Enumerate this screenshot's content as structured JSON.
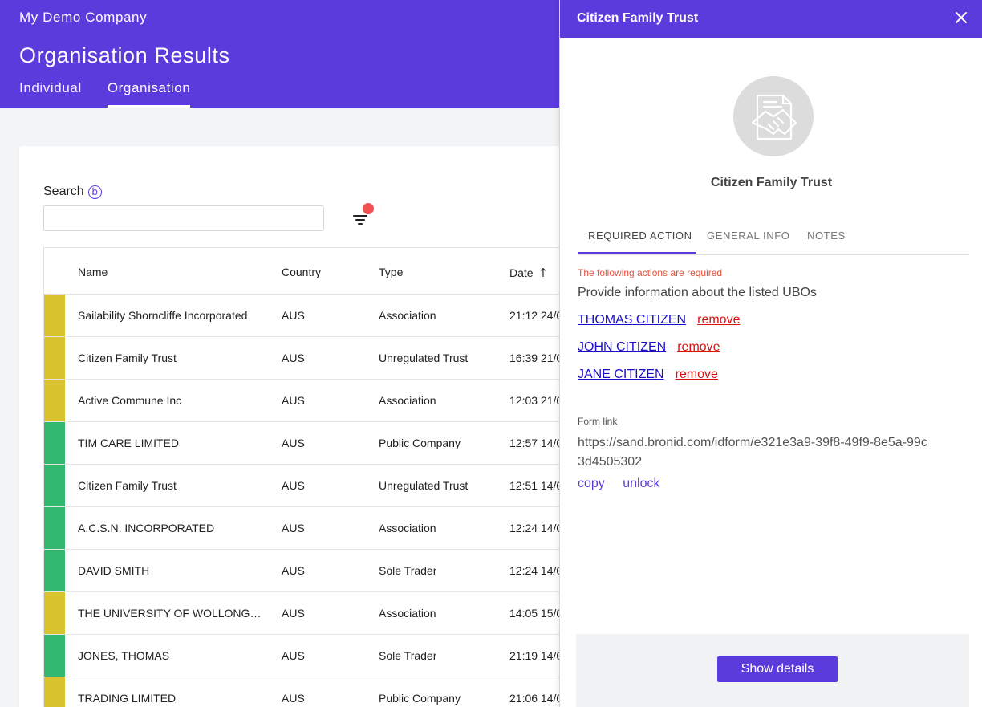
{
  "header": {
    "company": "My Demo Company",
    "title": "Organisation Results",
    "tabs": [
      {
        "label": "Individual",
        "active": false
      },
      {
        "label": "Organisation",
        "active": true
      }
    ]
  },
  "search": {
    "label": "Search",
    "info_icon": "b",
    "value": "",
    "placeholder": ""
  },
  "table": {
    "columns": [
      "Name",
      "Country",
      "Type",
      "Date"
    ],
    "sort_icon": "↑",
    "rows": [
      {
        "name": "Sailability Shorncliffe Incorporated",
        "country": "AUS",
        "type": "Association",
        "date": "21:12 24/0",
        "status": "yellow"
      },
      {
        "name": "Citizen Family Trust",
        "country": "AUS",
        "type": "Unregulated Trust",
        "date": "16:39 21/0",
        "status": "yellow"
      },
      {
        "name": "Active Commune Inc",
        "country": "AUS",
        "type": "Association",
        "date": "12:03 21/0",
        "status": "yellow"
      },
      {
        "name": "TIM CARE LIMITED",
        "country": "AUS",
        "type": "Public Company",
        "date": "12:57 14/0",
        "status": "green"
      },
      {
        "name": "Citizen Family Trust",
        "country": "AUS",
        "type": "Unregulated Trust",
        "date": "12:51 14/0",
        "status": "green"
      },
      {
        "name": "A.C.S.N. INCORPORATED",
        "country": "AUS",
        "type": "Association",
        "date": "12:24 14/0",
        "status": "green"
      },
      {
        "name": "DAVID SMITH",
        "country": "AUS",
        "type": "Sole Trader",
        "date": "12:24 14/0",
        "status": "green"
      },
      {
        "name": "THE UNIVERSITY OF WOLLONGO…",
        "country": "AUS",
        "type": "Association",
        "date": "14:05 15/0",
        "status": "yellow"
      },
      {
        "name": "JONES, THOMAS",
        "country": "AUS",
        "type": "Sole Trader",
        "date": "21:19 14/0",
        "status": "green"
      },
      {
        "name": "TRADING LIMITED",
        "country": "AUS",
        "type": "Public Company",
        "date": "21:06 14/0",
        "status": "yellow"
      }
    ]
  },
  "colors": {
    "accent": "#5b3bdc",
    "yellow": "#d9c430",
    "green": "#33b86f",
    "error": "#e5533e"
  },
  "drawer": {
    "title": "Citizen Family Trust",
    "entity_name": "Citizen Family Trust",
    "avatar_icon": "handshake-document-icon",
    "tabs": [
      {
        "label": "REQUIRED ACTION",
        "active": true
      },
      {
        "label": "GENERAL INFO",
        "active": false
      },
      {
        "label": "NOTES",
        "active": false
      }
    ],
    "required_note": "The following actions are required",
    "ubo_intro": "Provide information about the listed UBOs",
    "ubos": [
      {
        "name": "THOMAS CITIZEN",
        "remove": "remove"
      },
      {
        "name": "JOHN CITIZEN",
        "remove": "remove"
      },
      {
        "name": "JANE CITIZEN",
        "remove": "remove"
      }
    ],
    "form_link_label": "Form link",
    "form_link_url": "https://sand.bronid.com/idform/e321e3a9-39f8-49f9-8e5a-99c3d4505302",
    "copy_label": "copy",
    "unlock_label": "unlock",
    "show_details_label": "Show details"
  }
}
